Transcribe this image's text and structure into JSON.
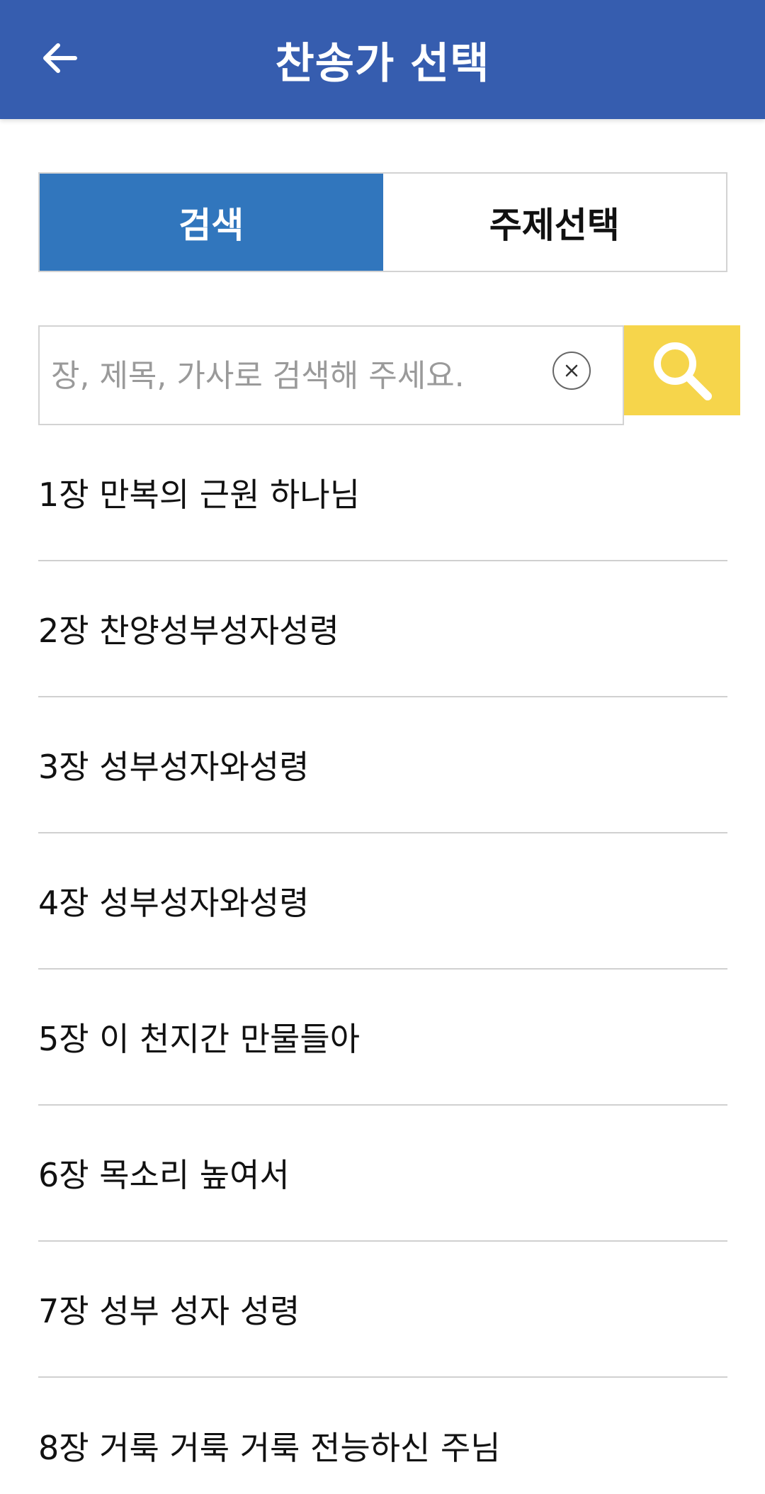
{
  "header": {
    "title": "찬송가 선택",
    "back_icon": "arrow-left-icon",
    "background_color": "#365daf"
  },
  "tabs": [
    {
      "label": "검색",
      "active": true
    },
    {
      "label": "주제선택",
      "active": false
    }
  ],
  "search": {
    "placeholder": "장, 제목, 가사로 검색해 주세요.",
    "value": "",
    "clear_icon": "clear-circle-x-icon",
    "search_icon": "magnifier-icon",
    "button_color": "#f6d54b"
  },
  "hymns": [
    {
      "title": "1장 만복의 근원 하나님"
    },
    {
      "title": "2장 찬양성부성자성령"
    },
    {
      "title": "3장 성부성자와성령"
    },
    {
      "title": "4장 성부성자와성령"
    },
    {
      "title": "5장 이 천지간 만물들아"
    },
    {
      "title": "6장 목소리 높여서"
    },
    {
      "title": "7장 성부 성자 성령"
    },
    {
      "title": "8장 거룩 거룩 거룩 전능하신 주님"
    }
  ],
  "colors": {
    "tab_active": "#3176bd",
    "divider": "#d0d0d0"
  }
}
